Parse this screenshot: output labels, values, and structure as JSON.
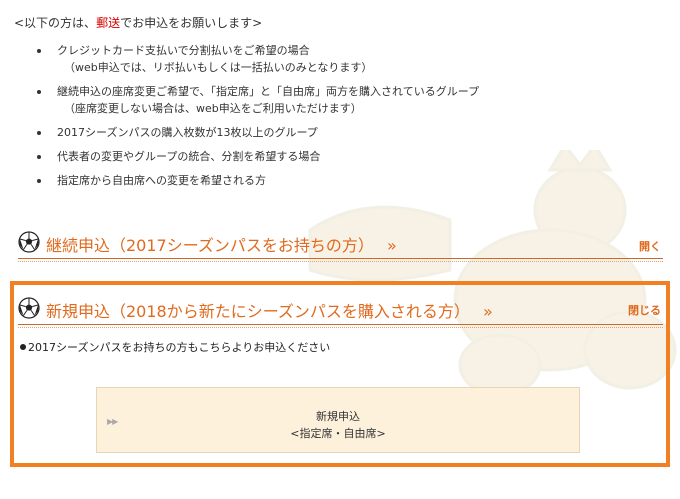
{
  "intro": {
    "prefix": "<以下の方は、",
    "highlight": "郵送",
    "suffix": "でお申込をお願いします>"
  },
  "bullets": [
    {
      "text": "クレジットカード支払いで分割払いをご希望の場合",
      "sub": "（web申込では、リボ払いもしくは一括払いのみとなります）"
    },
    {
      "text": "継続申込の座席変更ご希望で、「指定席」と「自由席」両方を購入されているグループ",
      "sub": "（座席変更しない場合は、web申込をご利用いただけます）"
    },
    {
      "text": "2017シーズンパスの購入枚数が13枚以上のグループ",
      "sub": ""
    },
    {
      "text": "代表者の変更やグループの統合、分割を希望する場合",
      "sub": ""
    },
    {
      "text": "指定席から自由席への変更を希望される方",
      "sub": ""
    }
  ],
  "renewal": {
    "title": "継続申込（2017シーズンパスをお持ちの方）",
    "chevron": "»",
    "toggle": "開く"
  },
  "new_app": {
    "title": "新規申込（2018から新たにシーズンパスを購入される方）",
    "chevron": "»",
    "toggle": "閉じる",
    "note": "2017シーズンパスをお持ちの方もこちらよりお申込ください",
    "button_line1": "新規申込",
    "button_line2": "<指定席・自由席>",
    "button_arrow": "▶▶"
  },
  "colors": {
    "accent": "#e06a1d",
    "frame": "#f08021",
    "highlight_red": "#d60000",
    "button_bg": "#fdf1dc"
  },
  "icons": [
    "soccer-ball-icon",
    "forward-arrow-icon"
  ]
}
